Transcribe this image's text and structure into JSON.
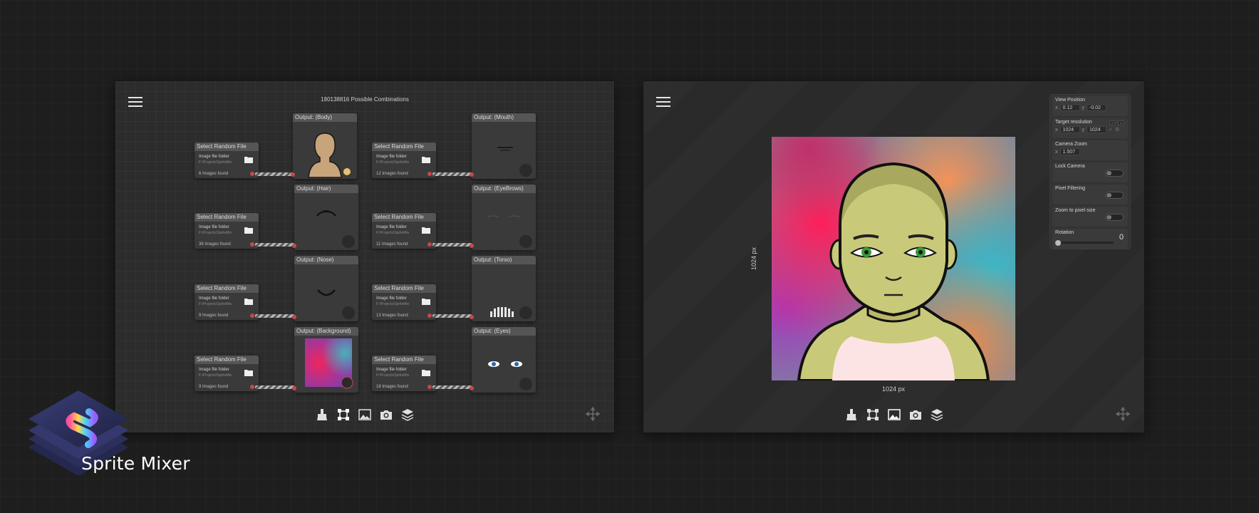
{
  "app": {
    "name": "Sprite Mixer",
    "logo_icon": "layered-s-logo-icon"
  },
  "graph_panel": {
    "combinations_text": "180138816 Possible Combinations",
    "menu_icon": "hamburger-icon",
    "select_nodes": [
      {
        "title": "Select Random File",
        "folder_label": "Image file folder",
        "folder_path": "F:\\Projects\\SpriteMix",
        "count": "6 Images found"
      },
      {
        "title": "Select Random File",
        "folder_label": "Image file folder",
        "folder_path": "F:\\Projects\\SpriteMix",
        "count": "12 Images found"
      },
      {
        "title": "Select Random File",
        "folder_label": "Image file folder",
        "folder_path": "F:\\Projects\\SpriteMix",
        "count": "38 Images found"
      },
      {
        "title": "Select Random File",
        "folder_label": "Image file folder",
        "folder_path": "F:\\Projects\\SpriteMix",
        "count": "11 Images found"
      },
      {
        "title": "Select Random File",
        "folder_label": "Image file folder",
        "folder_path": "F:\\Projects\\SpriteMix",
        "count": "9 Images found"
      },
      {
        "title": "Select Random File",
        "folder_label": "Image file folder",
        "folder_path": "F:\\Projects\\SpriteMix",
        "count": "13 Images found"
      },
      {
        "title": "Select Random File",
        "folder_label": "Image file folder",
        "folder_path": "F:\\Projects\\SpriteMix",
        "count": "9 Images found"
      },
      {
        "title": "Select Random File",
        "folder_label": "Image file folder",
        "folder_path": "F:\\Projects\\SpriteMix",
        "count": "18 Images found"
      }
    ],
    "output_nodes": [
      {
        "title": "Output: (Body)"
      },
      {
        "title": "Output: (Mouth)"
      },
      {
        "title": "Output: (Hair)"
      },
      {
        "title": "Output: (EyeBrows)"
      },
      {
        "title": "Output: (Nose)"
      },
      {
        "title": "Output: (Torso)"
      },
      {
        "title": "Output: (Background)"
      },
      {
        "title": "Output: (Eyes)"
      }
    ],
    "toolbar_icons": [
      "brush-icon",
      "node-graph-icon",
      "image-icon",
      "camera-icon",
      "layers-icon"
    ],
    "move_icon": "move-icon"
  },
  "preview_panel": {
    "menu_icon": "hamburger-icon",
    "width_label": "1024 px",
    "height_label": "1024 px",
    "properties": {
      "view_position": {
        "label": "View Position",
        "x_label": "x",
        "x": "0.12",
        "y_label": "y",
        "y": "-0.02"
      },
      "target_resolution": {
        "label": "Target resolution",
        "x_label": "x",
        "x": "1024",
        "y_label": "y",
        "y": "1024",
        "btn_a": "2",
        "btn_b": "4"
      },
      "camera_zoom": {
        "label": "Camera Zoom",
        "x_label": "x",
        "value": "1.507"
      },
      "lock_camera": {
        "label": "Lock Camera",
        "enabled": false
      },
      "pixel_filtering": {
        "label": "Pixel Filtering",
        "enabled": false
      },
      "zoom_to_pixel_size": {
        "label": "Zoom to pixel size",
        "enabled": false
      },
      "rotation": {
        "label": "Rotation",
        "value": "0"
      }
    },
    "toolbar_icons": [
      "brush-icon",
      "node-graph-icon",
      "image-icon",
      "camera-icon",
      "layers-icon"
    ],
    "move_icon": "move-icon"
  },
  "colors": {
    "bg_pink": "#f0255e",
    "bg_purple": "#8e3aa8",
    "bg_orange": "#f2935a",
    "bg_teal": "#4aa8b0",
    "skin": "#c9c97a",
    "body_tan": "#c8a47a"
  }
}
